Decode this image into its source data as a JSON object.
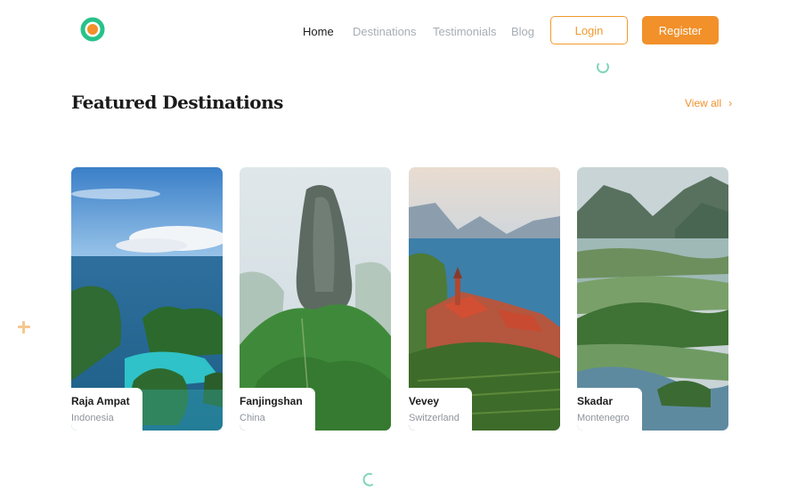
{
  "header": {
    "logo_icon": "ring-logo-icon",
    "nav": [
      {
        "label": "Home",
        "active": true
      },
      {
        "label": "Destinations",
        "active": false
      },
      {
        "label": "Testimonials",
        "active": false
      },
      {
        "label": "Blog",
        "active": false
      }
    ],
    "login_label": "Login",
    "register_label": "Register"
  },
  "section": {
    "title": "Featured Destinations",
    "view_all_label": "View all",
    "view_all_icon": "chevron-right-icon"
  },
  "destinations": [
    {
      "name": "Raja Ampat",
      "country": "Indonesia"
    },
    {
      "name": "Fanjingshan",
      "country": "China"
    },
    {
      "name": "Vevey",
      "country": "Switzerland"
    },
    {
      "name": "Skadar",
      "country": "Montenegro"
    }
  ],
  "colors": {
    "accent": "#f2902a",
    "logo_green": "#27c28a",
    "logo_orange": "#f2902a",
    "loader_teal": "#7fd6b8"
  }
}
